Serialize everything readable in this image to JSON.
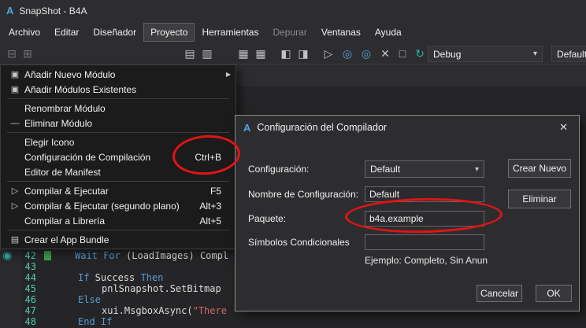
{
  "colors": {
    "annotation": "#e11414",
    "keyword": "#569cd6",
    "string": "#d16969",
    "line_number": "#4ec9b0",
    "accent_blue": "#4da6d9"
  },
  "app": {
    "icon_letter": "A",
    "title": "SnapShot - B4A"
  },
  "menubar": {
    "items": [
      "Archivo",
      "Editar",
      "Diseñador",
      "Proyecto",
      "Herramientas",
      "Depurar",
      "Ventanas",
      "Ayuda"
    ]
  },
  "toolbar": {
    "icons": [
      {
        "name": "views-icon",
        "glyph": "⊟"
      },
      {
        "name": "designer-icon",
        "glyph": "⊞"
      },
      {
        "name": "panel-left-icon",
        "glyph": "▤"
      },
      {
        "name": "panel-right-icon",
        "glyph": "▥"
      },
      {
        "name": "modules-icon",
        "glyph": "▦"
      },
      {
        "name": "layouts-icon",
        "glyph": "▦"
      },
      {
        "name": "split-left-icon",
        "glyph": "◧"
      },
      {
        "name": "split-right-icon",
        "glyph": "◨"
      },
      {
        "name": "run-icon",
        "glyph": "▷"
      },
      {
        "name": "bridge-icon",
        "glyph": "◎"
      },
      {
        "name": "usb-debug-icon",
        "glyph": "◎"
      },
      {
        "name": "disconnect-icon",
        "glyph": "✕"
      },
      {
        "name": "stop-icon",
        "glyph": "□"
      },
      {
        "name": "logs-icon",
        "glyph": "↻"
      }
    ],
    "debug_combo": "Debug",
    "default_combo": "Default",
    "combo_arrow": "▾"
  },
  "project_menu": {
    "items": [
      {
        "icon": "▣",
        "label": "Añadir Nuevo Módulo",
        "shortcut": "",
        "submenu": "▶"
      },
      {
        "icon": "▣",
        "label": "Añadir Módulos Existentes"
      },
      {
        "label": "Renombrar Módulo"
      },
      {
        "icon": "—",
        "label": "Eliminar Módulo"
      },
      {
        "label": "Elegir Icono"
      },
      {
        "label": "Configuración de Compilación",
        "shortcut": "Ctrl+B"
      },
      {
        "label": "Editor de Manifest"
      },
      {
        "icon": "▷",
        "label": "Compilar & Ejecutar",
        "shortcut": "F5"
      },
      {
        "icon": "▷",
        "label": "Compilar & Ejecutar (segundo plano)",
        "shortcut": "Alt+3"
      },
      {
        "label": "Compilar a Librería",
        "shortcut": "Alt+5"
      },
      {
        "icon": "▤",
        "label": "Crear el App Bundle"
      }
    ]
  },
  "dialog": {
    "icon_letter": "A",
    "title": "Configuración del Compilador",
    "close_glyph": "✕",
    "combo_arrow": "▾",
    "config_label": "Configuración:",
    "config_value": "Default",
    "create_button": "Crear Nuevo",
    "name_label": "Nombre de Configuración:",
    "name_value": "Default",
    "delete_button": "Eliminar",
    "package_label": "Paquete:",
    "package_value": "b4a.example",
    "symbols_label": "Símbolos Condicionales",
    "symbols_value": "",
    "hint": "Ejemplo: Completo, Sin Anun",
    "cancel_button": "Cancelar",
    "ok_button": "OK"
  },
  "editor": {
    "lines": [
      {
        "num": "42",
        "a": "Wait For",
        "b": " (LoadImages) Compl"
      },
      {
        "num": "43"
      },
      {
        "num": "44",
        "a": "If",
        "b": " Success ",
        "c": "Then"
      },
      {
        "num": "45",
        "a": "pnlSnapshot.SetBitmap"
      },
      {
        "num": "46",
        "a": "Else"
      },
      {
        "num": "47",
        "a": "xui.MsgboxAsync(",
        "b": "\"There"
      },
      {
        "num": "48",
        "a": "End If"
      }
    ]
  }
}
